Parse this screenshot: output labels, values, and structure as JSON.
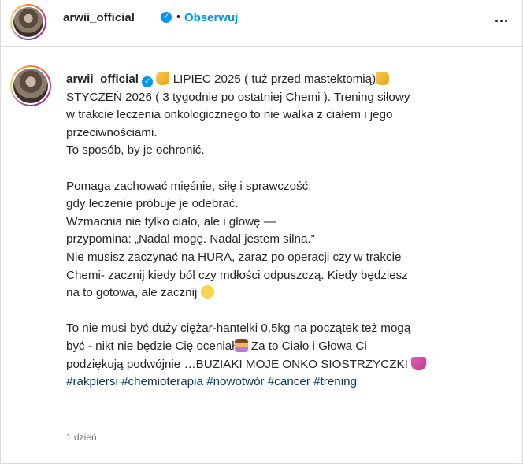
{
  "header": {
    "username": "arwii_official",
    "separator": "•",
    "follow_label": "Obserwuj",
    "more_label": "..."
  },
  "caption": {
    "username": "arwii_official",
    "line1_text": "LIPIEC 2025 ( tuż przed mastektomią)",
    "line2_text": "STYCZEŃ 2026 ( 3 tygodnie po ostatniej Chemi ). Trening siłowy",
    "line3": "w trakcie leczenia onkologicznego to nie walka z ciałem i jego",
    "line4": "przeciwnościami.",
    "line5": "To sposób, by je ochronić.",
    "line6": "Pomaga zachować mięśnie, siłę i sprawczość,",
    "line7": "gdy leczenie próbuje je odebrać.",
    "line8": "Wzmacnia nie tylko ciało, ale i głowę —",
    "line9": "przypomina: „Nadal mogę. Nadal jestem silna.”",
    "line10": "Nie musisz zaczynać na HURA, zaraz po operacji czy w trakcie",
    "line11": "Chemi- zacznij kiedy ból czy mdłości odpuszczą. Kiedy będziesz",
    "line12_text": "na to gotowa, ale zacznij",
    "line13": "To nie musi być duży ciężar-hantelki 0,5kg na początek też mogą",
    "line14a": "być - nikt nie będzie Cię oceniał",
    "line14b": "Za to Ciało i Głowa Ci",
    "line15_text": "podziękują podwójnie …BUZIAKI MOJE ONKO SIOSTRZYCZKI",
    "hashtags": [
      "#rakpiersi",
      "#chemioterapia",
      "#nowotwór",
      "#cancer",
      "#trening"
    ]
  },
  "timestamp": "1 dzień",
  "icons": {
    "verified": "verified-badge-icon",
    "more": "more-options-icon",
    "emoji_1": "backhand-index-pointing-left-emoji",
    "emoji_2": "backhand-index-pointing-right-emoji",
    "emoji_3": "smiling-face-emoji",
    "emoji_4": "woman-raising-hand-emoji",
    "emoji_5": "pink-ribbon-emoji"
  },
  "colors": {
    "link": "#0095f6",
    "hashtag": "#00376b",
    "text": "#262626",
    "muted": "#737373",
    "border": "#dbdbdb"
  }
}
